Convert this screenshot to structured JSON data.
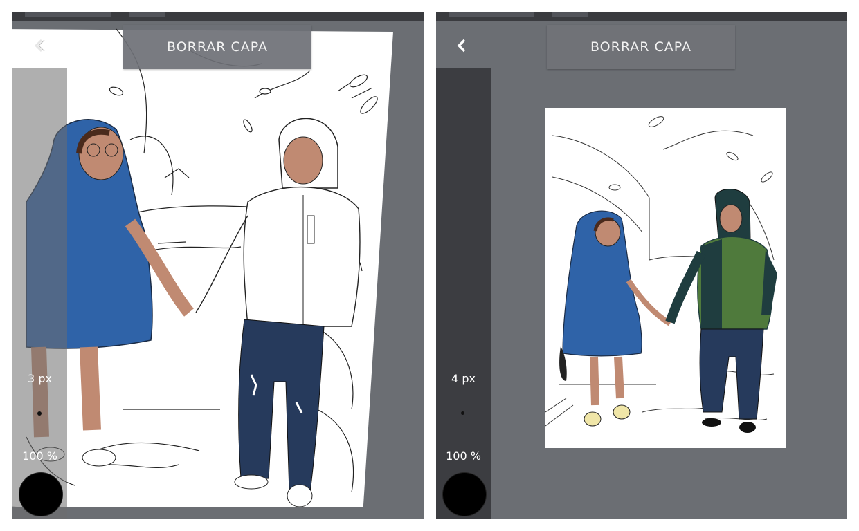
{
  "panels": [
    {
      "id": "left",
      "clear_layer_label": "BORRAR CAPA",
      "brush_size": "3 px",
      "opacity": "100 %",
      "color": "#000000",
      "icons": {
        "back": "chevron-left-icon"
      }
    },
    {
      "id": "right",
      "clear_layer_label": "BORRAR CAPA",
      "brush_size": "4 px",
      "opacity": "100 %",
      "color": "#000000",
      "icons": {
        "back": "chevron-left-icon"
      }
    }
  ],
  "colors": {
    "workspace": "#6b6e73",
    "toolbar_dark": "#3c3d41",
    "coat_blue": "#2f63a8",
    "jacket_green": "#4f7a3c",
    "jacket_dark": "#1f3d3f",
    "jeans": "#263a5c",
    "skin": "#c08a72"
  }
}
